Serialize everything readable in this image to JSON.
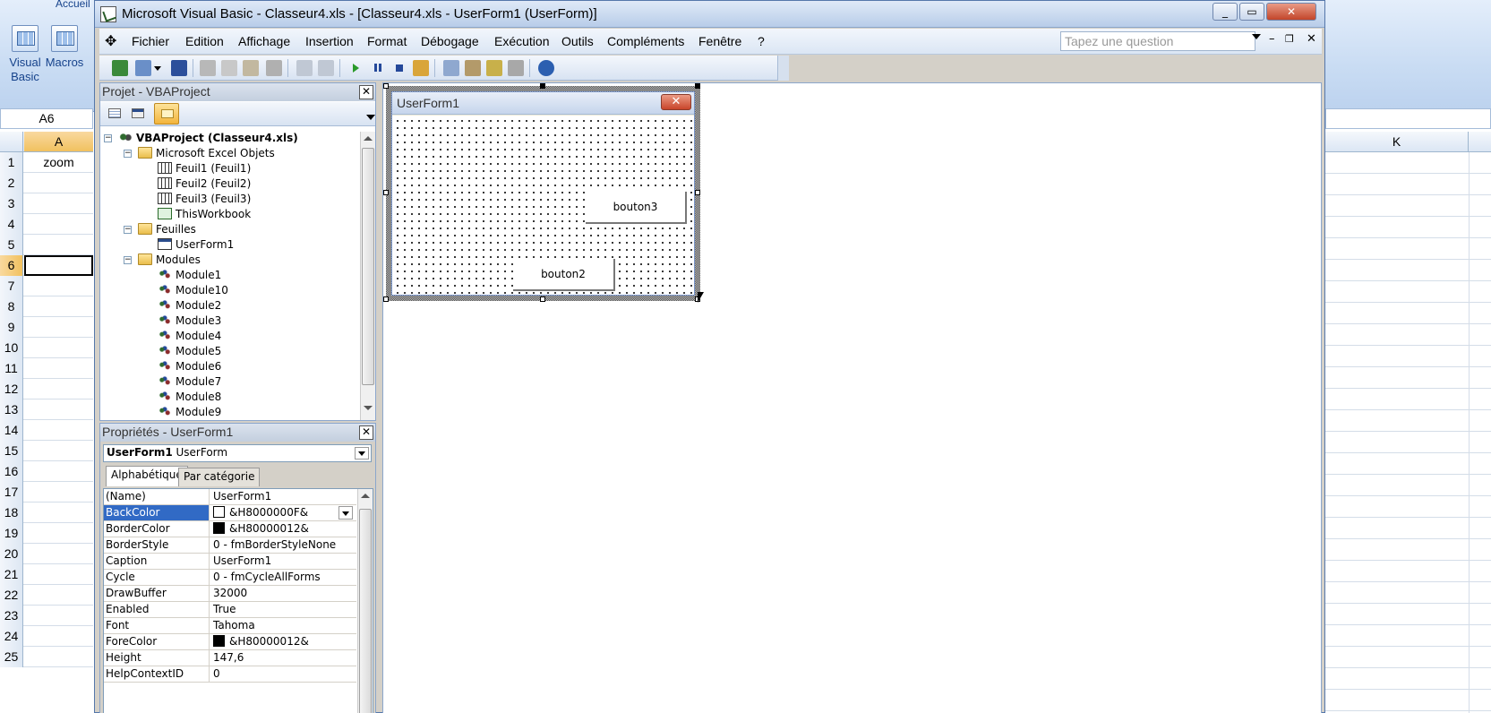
{
  "excel": {
    "ribbon_tab": "Accueil",
    "ribbon_buttons": {
      "visual_basic": "Visual Basic",
      "macros": "Macros"
    },
    "name_box": "A6",
    "col_a": "A",
    "col_k": "K",
    "rows": [
      "1",
      "2",
      "3",
      "4",
      "5",
      "6",
      "7",
      "8",
      "9",
      "10",
      "11",
      "12",
      "13",
      "14",
      "15",
      "16",
      "17",
      "18",
      "19",
      "20",
      "21",
      "22",
      "23",
      "24",
      "25"
    ],
    "cell_a1": "zoom",
    "active_row": "6"
  },
  "vbe": {
    "title": "Microsoft Visual Basic - Classeur4.xls - [Classeur4.xls - UserForm1 (UserForm)]",
    "menu": [
      "Fichier",
      "Edition",
      "Affichage",
      "Insertion",
      "Format",
      "Débogage",
      "Exécution",
      "Outils",
      "Compléments",
      "Fenêtre",
      "?"
    ],
    "ask_placeholder": "Tapez une question"
  },
  "project": {
    "title": "Projet - VBAProject",
    "root": "VBAProject (Classeur4.xls)",
    "excel_objects_folder": "Microsoft Excel Objets",
    "sheets": [
      "Feuil1 (Feuil1)",
      "Feuil2 (Feuil2)",
      "Feuil3 (Feuil3)"
    ],
    "workbook": "ThisWorkbook",
    "forms_folder": "Feuilles",
    "forms": [
      "UserForm1"
    ],
    "modules_folder": "Modules",
    "modules": [
      "Module1",
      "Module10",
      "Module2",
      "Module3",
      "Module4",
      "Module5",
      "Module6",
      "Module7",
      "Module8",
      "Module9"
    ]
  },
  "properties": {
    "title": "Propriétés - UserForm1",
    "object_name": "UserForm1",
    "object_type": "UserForm",
    "tabs": [
      "Alphabétique",
      "Par catégorie"
    ],
    "rows": [
      {
        "name": "(Name)",
        "value": "UserForm1"
      },
      {
        "name": "BackColor",
        "value": "&H8000000F&",
        "swatch": "#ffffff"
      },
      {
        "name": "BorderColor",
        "value": "&H80000012&",
        "swatch": "#000000"
      },
      {
        "name": "BorderStyle",
        "value": "0 - fmBorderStyleNone"
      },
      {
        "name": "Caption",
        "value": "UserForm1"
      },
      {
        "name": "Cycle",
        "value": "0 - fmCycleAllForms"
      },
      {
        "name": "DrawBuffer",
        "value": "32000"
      },
      {
        "name": "Enabled",
        "value": "True"
      },
      {
        "name": "Font",
        "value": "Tahoma"
      },
      {
        "name": "ForeColor",
        "value": "&H80000012&",
        "swatch": "#000000"
      },
      {
        "name": "Height",
        "value": "147,6"
      },
      {
        "name": "HelpContextID",
        "value": "0"
      }
    ],
    "selected_row": "BackColor"
  },
  "designer": {
    "form_caption": "UserForm1",
    "buttons": [
      "bouton3",
      "bouton2"
    ]
  }
}
